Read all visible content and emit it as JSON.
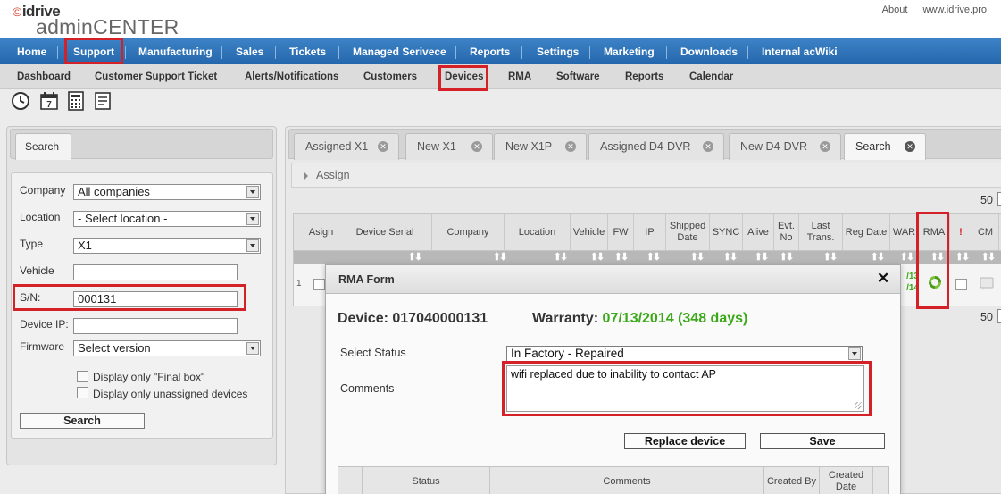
{
  "header": {
    "logo_top": "idrive",
    "logo_bottom_prefix": "admin",
    "logo_bottom_suffix": "CENTER",
    "links": [
      "About",
      "www.idrive.pro"
    ]
  },
  "main_nav": [
    "Home",
    "Support",
    "Manufacturing",
    "Sales",
    "Tickets",
    "Managed Serivece",
    "Reports",
    "Settings",
    "Marketing",
    "Downloads",
    "Internal acWiki"
  ],
  "sub_nav": [
    "Dashboard",
    "Customer Support Ticket",
    "Alerts/Notifications",
    "Customers",
    "Devices",
    "RMA",
    "Software",
    "Reports",
    "Calendar"
  ],
  "toolbar_icons": [
    "clock-icon",
    "calendar-icon",
    "calculator-icon",
    "list-icon"
  ],
  "search_panel": {
    "tab": "Search",
    "company_label": "Company",
    "company_value": "All companies",
    "location_label": "Location",
    "location_value": "- Select location -",
    "type_label": "Type",
    "type_value": "X1",
    "vehicle_label": "Vehicle",
    "vehicle_value": "",
    "sn_label": "S/N:",
    "sn_value": "000131",
    "device_ip_label": "Device IP:",
    "device_ip_value": "",
    "firmware_label": "Firmware",
    "firmware_value": "Select version",
    "final_box_label": "Display only \"Final box\"",
    "unassigned_label": "Display only unassigned devices",
    "search_button": "Search"
  },
  "tabs": [
    {
      "label": "Assigned X1"
    },
    {
      "label": "New X1"
    },
    {
      "label": "New X1P"
    },
    {
      "label": "Assigned D4-DVR"
    },
    {
      "label": "New D4-DVR"
    },
    {
      "label": "Search"
    }
  ],
  "assign_label": "Assign",
  "pager": {
    "top": "50",
    "bottom": "50"
  },
  "grid": {
    "columns": [
      "Asign",
      "Device Serial",
      "Company",
      "Location",
      "Vehicle",
      "FW",
      "IP",
      "Shipped Date",
      "SYNC",
      "Alive",
      "Evt. No",
      "Last Trans.",
      "Reg Date",
      "WAR",
      "RMA",
      "!",
      "CM"
    ],
    "row_number": "1",
    "war_cell": "/13\n/14"
  },
  "modal": {
    "title": "RMA Form",
    "device_label": "Device:",
    "device_value": "017040000131",
    "warranty_label": "Warranty:",
    "warranty_value": "07/13/2014 (348 days)",
    "select_status_label": "Select Status",
    "status_value": "In Factory - Repaired",
    "comments_label": "Comments",
    "comments_value": "wifi replaced due to inability to contact AP",
    "replace_button": "Replace device",
    "save_button": "Save",
    "history_columns": [
      "",
      "Status",
      "Comments",
      "Created By",
      "Created Date"
    ]
  },
  "colors": {
    "nav_blue": "#2d72b8",
    "highlight_red": "#d42127",
    "warranty_green": "#3aa918",
    "rma_icon_green": "#4e9a1c"
  }
}
